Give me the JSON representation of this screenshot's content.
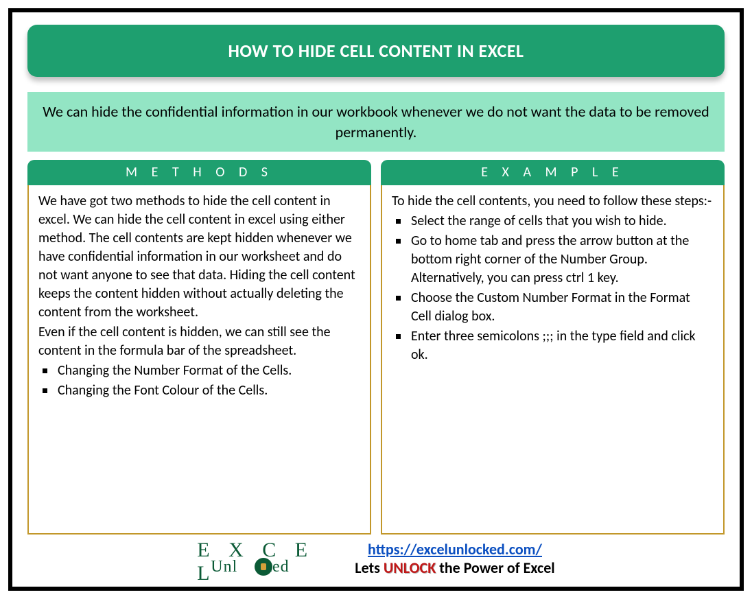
{
  "title": "HOW TO HIDE CELL CONTENT IN EXCEL",
  "intro": "We can hide the confidential information in our workbook whenever we do not want the data to be removed permanently.",
  "left": {
    "header": "M E T H O D S",
    "para1": "We have got two methods to hide the cell content in excel. We can hide the cell content in excel using either method. The cell contents are kept hidden whenever we have confidential information in our worksheet and do not want anyone to see that data. Hiding the cell content keeps the content hidden without actually deleting the content from the worksheet.",
    "para2": "Even if the cell content is hidden, we can still see the content in the formula bar of the spreadsheet.",
    "bullets": [
      "Changing the Number Format of the Cells.",
      "Changing the Font Colour of the Cells."
    ]
  },
  "right": {
    "header": "E X A M P L E",
    "intro": "To hide the cell contents, you need to follow these steps:-",
    "steps": [
      "Select the range of cells that you wish to hide.",
      "Go to home tab and press the arrow button at the bottom right corner of the Number Group. Alternatively, you can press ctrl 1 key.",
      "Choose the Custom Number Format in the Format Cell dialog box.",
      "Enter three semicolons ;;; in the type field and click ok."
    ]
  },
  "footer": {
    "logo_top": "E X C E L",
    "logo_bottom_left": "Unl",
    "logo_bottom_right": "cked",
    "url": "https://excelunlocked.com/",
    "tagline_pre": "Lets ",
    "tagline_word": "UNLOCK",
    "tagline_post": " the Power of Excel"
  }
}
